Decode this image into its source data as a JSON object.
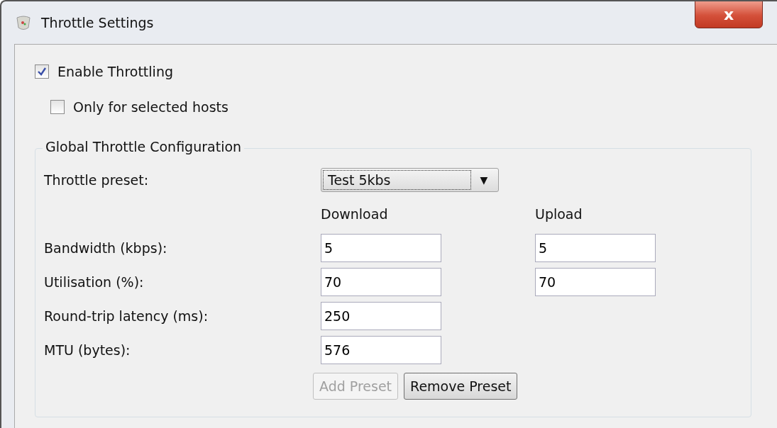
{
  "window": {
    "title": "Throttle Settings",
    "close": "x"
  },
  "options": [
    {
      "label": "Enable Throttling",
      "checked": true
    },
    {
      "label": "Only for selected hosts",
      "checked": false
    }
  ],
  "group": {
    "title": "Global Throttle Configuration",
    "preset": {
      "label": "Throttle preset:",
      "value": "Test 5kbs",
      "arrow": "▼"
    },
    "columns": [
      "Download",
      "Upload"
    ],
    "rows": [
      {
        "label": "Bandwidth (kbps):",
        "download": "5",
        "upload": "5"
      },
      {
        "label": "Utilisation (%):",
        "download": "70",
        "upload": "70"
      },
      {
        "label": "Round-trip latency (ms):",
        "download": "250"
      },
      {
        "label": "MTU (bytes):",
        "download": "576"
      }
    ],
    "buttons": [
      {
        "label": "Add Preset",
        "disabled": true
      },
      {
        "label": "Remove Preset",
        "disabled": false
      }
    ]
  }
}
